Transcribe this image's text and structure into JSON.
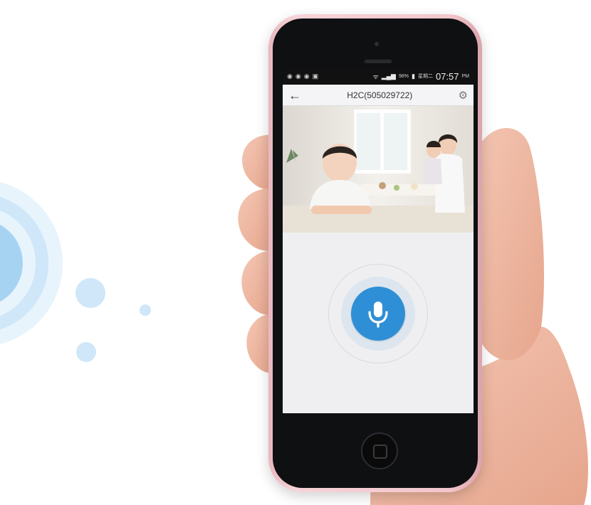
{
  "colors": {
    "accent": "#2f8fd6",
    "phone_case": "#f2c6cc",
    "screen_bg": "#efeff1",
    "ring_light": "#dbecf8",
    "ring_mid": "#a9d4f3"
  },
  "statusbar": {
    "battery": "98%",
    "date_label": "星期二",
    "time": "07:57",
    "ampm": "PM"
  },
  "titlebar": {
    "title": "H2C(505029722)",
    "back_icon": "arrow-left-icon",
    "settings_icon": "gear-icon"
  },
  "video": {
    "description_icon": "live-camera-feed"
  },
  "talk": {
    "mic_icon": "microphone-icon"
  }
}
